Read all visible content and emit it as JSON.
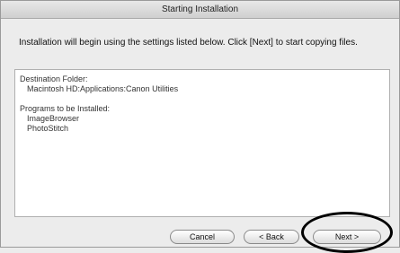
{
  "window": {
    "title": "Starting Installation"
  },
  "instruction": "Installation will begin using the settings listed below. Click [Next] to start copying files.",
  "settings": {
    "destination_label": "Destination Folder:",
    "destination_value": "Macintosh HD:Applications:Canon Utilities",
    "programs_label": "Programs to be Installed:",
    "programs": [
      "ImageBrowser",
      "PhotoStitch"
    ]
  },
  "buttons": {
    "cancel": "Cancel",
    "back": "< Back",
    "next": "Next >"
  }
}
